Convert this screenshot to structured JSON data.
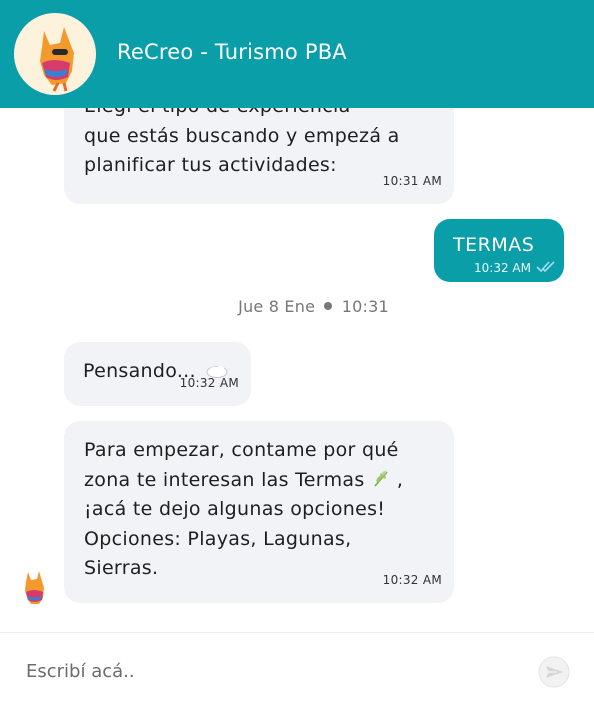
{
  "header": {
    "title": "ReCreo - Turismo PBA",
    "brand_color": "#0a9ea9"
  },
  "messages": [
    {
      "direction": "incoming",
      "text": "Elegí el tipo de experiencia\nque estás buscando y empezá a\nplanificar tus actividades:",
      "time": "10:31 AM",
      "icon": "calendar-emoji-icon"
    },
    {
      "direction": "outgoing",
      "text": "TERMAS",
      "time": "10:32 AM",
      "status": "read-double-check-icon"
    },
    {
      "direction": "incoming",
      "text": "Pensando...",
      "time": "10:32 AM",
      "icon": "thought-cloud-icon"
    },
    {
      "direction": "incoming",
      "text_before_icon": "Para empezar, contame por qué\nzona te interesan las Termas",
      "text_after_icon": " ,\n¡acá te dejo algunas opciones!\nOpciones: Playas, Lagunas,\nSierras.",
      "time": "10:32 AM",
      "icon": "herb-emoji-icon"
    }
  ],
  "date_separator": {
    "day": "Jue 8 Ene",
    "time": "10:31"
  },
  "input": {
    "placeholder": "Escribí acá.."
  }
}
